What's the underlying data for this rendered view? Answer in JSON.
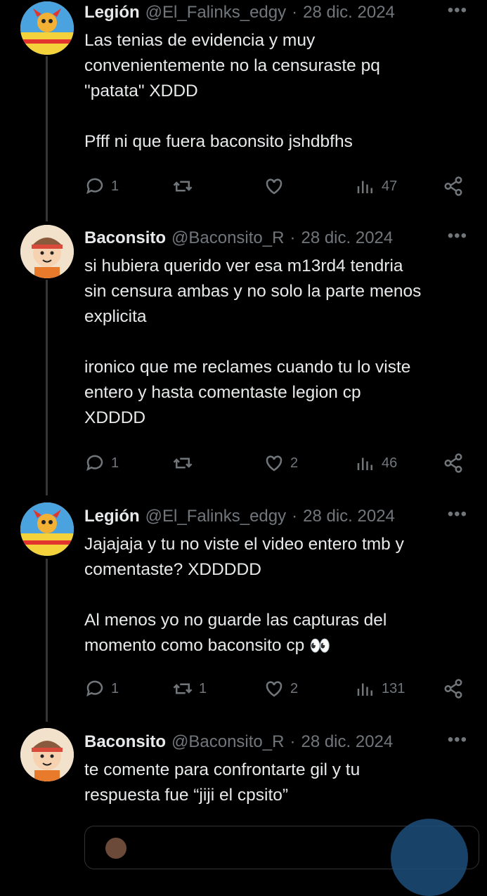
{
  "tweets": [
    {
      "name": "Legión",
      "handle": "@El_Falinks_edgy",
      "date": "28 dic. 2024",
      "lines": [
        "Las tenias de evidencia y muy",
        "convenientemente no la censuraste pq",
        "\"patata\" XDDD",
        "",
        "Pfff ni que fuera baconsito jshdbfhs"
      ],
      "replies": "1",
      "retweets": "",
      "likes": "",
      "views": "47"
    },
    {
      "name": "Baconsito",
      "handle": "@Baconsito_R",
      "date": "28 dic. 2024",
      "lines": [
        "si hubiera querido ver esa m13rd4 tendria",
        "sin censura ambas y no solo la parte menos",
        "explicita",
        "",
        "ironico que me reclames cuando tu lo viste",
        "entero y hasta comentaste legion cp",
        "XDDDD"
      ],
      "replies": "1",
      "retweets": "",
      "likes": "2",
      "views": "46"
    },
    {
      "name": "Legión",
      "handle": "@El_Falinks_edgy",
      "date": "28 dic. 2024",
      "lines": [
        "Jajajaja y tu no viste el video entero tmb y",
        "comentaste? XDDDDD",
        "",
        "Al menos yo no guarde las capturas del",
        "momento como baconsito cp"
      ],
      "emoji": "👀",
      "replies": "1",
      "retweets": "1",
      "likes": "2",
      "views": "131"
    },
    {
      "name": "Baconsito",
      "handle": "@Baconsito_R",
      "date": "28 dic. 2024",
      "lines": [
        "te comente para confrontarte gil y tu",
        "respuesta fue “jiji el cpsito”"
      ]
    }
  ],
  "more_label": "•••",
  "icons": {
    "reply": "reply-icon",
    "retweet": "retweet-icon",
    "like": "like-icon",
    "views": "views-icon",
    "share": "share-icon",
    "more": "more-icon"
  },
  "colors": {
    "background": "#000000",
    "text": "#e7e9ea",
    "muted": "#71767b",
    "line": "#333639"
  }
}
